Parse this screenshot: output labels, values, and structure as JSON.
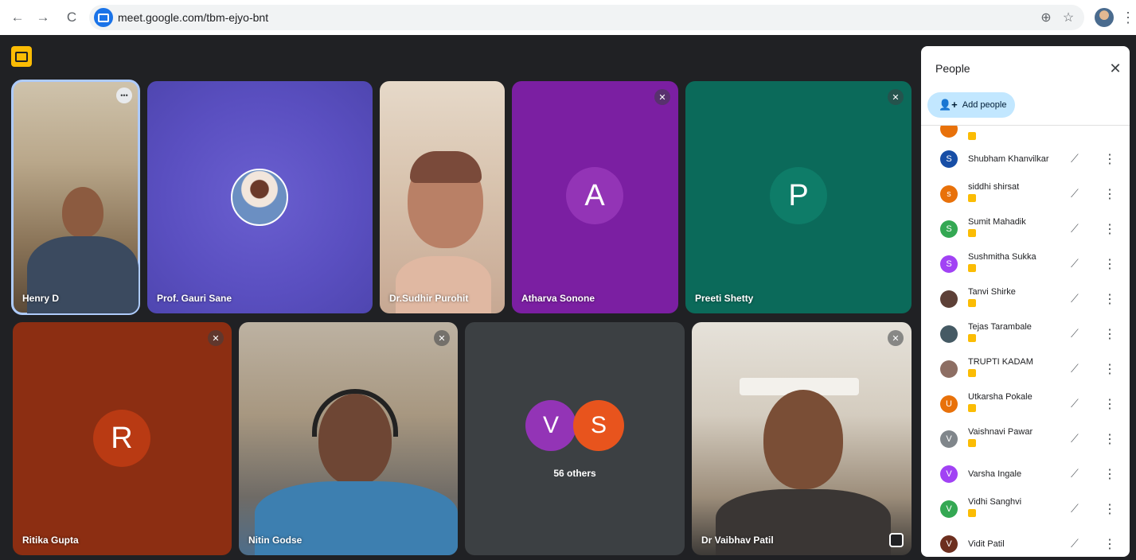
{
  "browser": {
    "url": "meet.google.com/tbm-ejyo-bnt",
    "back_glyph": "←",
    "forward_glyph": "→",
    "reload_glyph": "C",
    "zoom_glyph": "⊕",
    "star_glyph": "☆",
    "menu_glyph": "⋮"
  },
  "tiles": {
    "henry": {
      "name": "Henry D",
      "more": "•••"
    },
    "gauri": {
      "name": "Prof. Gauri Sane"
    },
    "sudhir": {
      "name": "Dr.Sudhir Purohit"
    },
    "atharva": {
      "name": "Atharva Sonone",
      "initial": "A"
    },
    "preeti": {
      "name": "Preeti Shetty",
      "initial": "P"
    },
    "ritika": {
      "name": "Ritika Gupta",
      "initial": "R"
    },
    "nitin": {
      "name": "Nitin Godse"
    },
    "others": {
      "label": "56 others",
      "initial_1": "V",
      "initial_2": "S"
    },
    "vaibhav": {
      "name": "Dr Vaibhav Patil"
    }
  },
  "people_panel": {
    "title": "People",
    "close_glyph": "✕",
    "add_people_label": "Add people",
    "add_people_glyph": "👤+",
    "mic_glyph": "🎙",
    "more_glyph": "⋮",
    "participants": [
      {
        "name": "Shubham Khanvilkar",
        "initial": "S",
        "color": "#174ea6",
        "hand": false
      },
      {
        "name": "siddhi shirsat",
        "initial": "s",
        "color": "#e8710a",
        "hand": true
      },
      {
        "name": "Sumit Mahadik",
        "initial": "S",
        "color": "#34a853",
        "hand": true
      },
      {
        "name": "Sushmitha Sukka",
        "initial": "S",
        "color": "#a142f4",
        "hand": true
      },
      {
        "name": "Tanvi Shirke",
        "initial": "",
        "color": "#5d4037",
        "hand": true
      },
      {
        "name": "Tejas Tarambale",
        "initial": "",
        "color": "#455a64",
        "hand": true
      },
      {
        "name": "TRUPTI KADAM",
        "initial": "",
        "color": "#8d6e63",
        "hand": true
      },
      {
        "name": "Utkarsha Pokale",
        "initial": "U",
        "color": "#e8710a",
        "hand": true
      },
      {
        "name": "Vaishnavi Pawar",
        "initial": "V",
        "color": "#80868b",
        "hand": true
      },
      {
        "name": "Varsha Ingale",
        "initial": "V",
        "color": "#a142f4",
        "hand": false
      },
      {
        "name": "Vidhi Sanghvi",
        "initial": "V",
        "color": "#34a853",
        "hand": true
      },
      {
        "name": "Vidit Patil",
        "initial": "V",
        "color": "#6d2f1f",
        "hand": false
      }
    ]
  }
}
